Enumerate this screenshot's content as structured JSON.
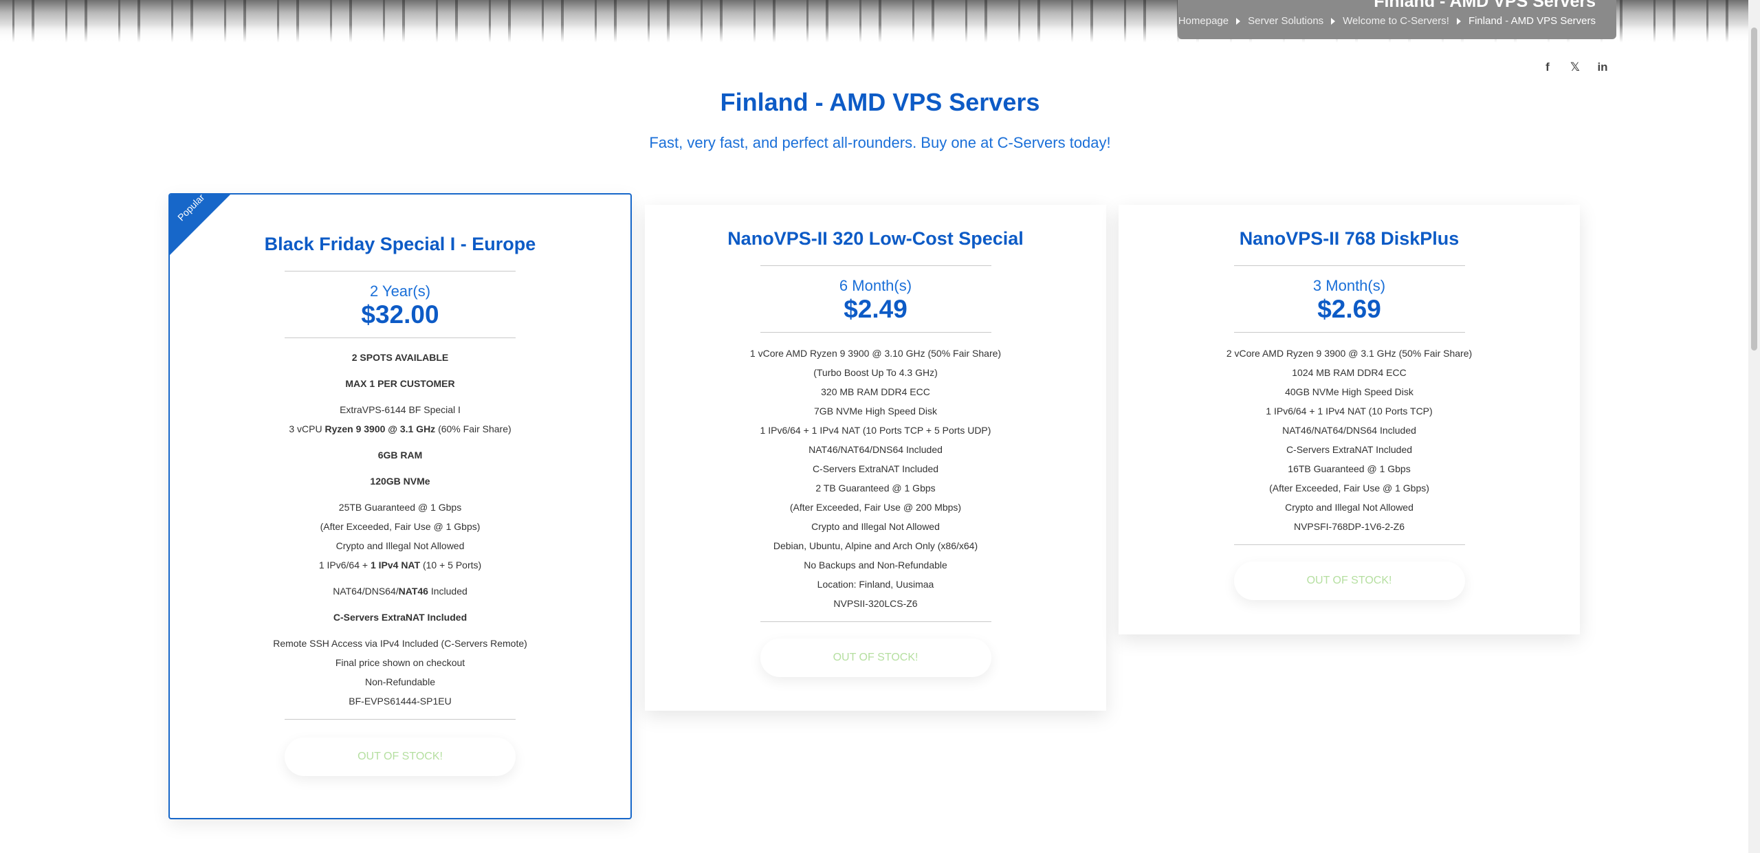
{
  "header": {
    "title": "Finland - AMD VPS Servers",
    "breadcrumb": [
      "Homepage",
      "Server Solutions",
      "Welcome to C-Servers!",
      "Finland - AMD VPS Servers"
    ]
  },
  "social": {
    "facebook": "f",
    "x": "𝕏",
    "linkedin": "in"
  },
  "main": {
    "heading": "Finland - AMD VPS Servers",
    "subheading": "Fast, very fast, and perfect all-rounders. Buy one at C-Servers today!"
  },
  "plans": [
    {
      "ribbon": "Popular",
      "title": "Black Friday Special I - Europe",
      "period": "2 Year(s)",
      "price": "$32.00",
      "features": {
        "spots": "2 SPOTS AVAILABLE",
        "limit": "MAX 1 PER CUSTOMER",
        "name": "ExtraVPS-6144 BF Special I",
        "cpu_pre": "3 vCPU ",
        "cpu_bold": "Ryzen 9 3900 @ 3.1 GHz",
        "cpu_post": " (60% Fair Share)",
        "ram": "6GB RAM",
        "disk": "120GB NVMe",
        "traffic": "25TB Guaranteed @ 1 Gbps",
        "traffic_after": "(After Exceeded, Fair Use @ 1 Gbps)",
        "crypto": "Crypto and Illegal Not Allowed",
        "ip_pre": "1 IPv6/64 + ",
        "ip_bold": "1 IPv4 NAT",
        "ip_post": " (10 + 5 Ports)",
        "nat_pre": "NAT64/DNS64/",
        "nat_bold": "NAT46",
        "nat_post": " Included",
        "extranat": "C-Servers ExtraNAT Included",
        "ssh": "Remote SSH Access via IPv4 Included (C-Servers Remote)",
        "checkout": "Final price shown on checkout",
        "refund": "Non-Refundable",
        "sku": "BF-EVPS61444-SP1EU"
      },
      "button": "OUT OF STOCK!"
    },
    {
      "title": "NanoVPS-II 320 Low-Cost Special",
      "period": "6 Month(s)",
      "price": "$2.49",
      "features": [
        "1 vCore AMD Ryzen 9 3900 @ 3.10 GHz (50% Fair Share)",
        "(Turbo Boost Up To 4.3 GHz)",
        "320 MB RAM DDR4 ECC",
        "7GB NVMe High Speed Disk",
        "1 IPv6/64 + 1 IPv4 NAT (10 Ports TCP + 5 Ports UDP)",
        "NAT46/NAT64/DNS64 Included",
        "C-Servers ExtraNAT Included",
        "2 TB Guaranteed @ 1 Gbps",
        "(After Exceeded, Fair Use @ 200 Mbps)",
        "Crypto and Illegal Not Allowed",
        "Debian, Ubuntu, Alpine and Arch Only (x86/x64)",
        "No Backups and Non-Refundable",
        "Location: Finland, Uusimaa",
        "NVPSII-320LCS-Z6"
      ],
      "button": "OUT OF STOCK!"
    },
    {
      "title": "NanoVPS-II 768 DiskPlus",
      "period": "3 Month(s)",
      "price": "$2.69",
      "features": [
        "2 vCore AMD Ryzen 9 3900 @ 3.1 GHz (50% Fair Share)",
        "1024 MB RAM DDR4 ECC",
        "40GB NVMe High Speed Disk",
        "1 IPv6/64 + 1 IPv4 NAT (10 Ports TCP)",
        "NAT46/NAT64/DNS64 Included",
        "C-Servers ExtraNAT Included",
        "16TB Guaranteed @ 1 Gbps",
        "(After Exceeded, Fair Use @ 1 Gbps)",
        "Crypto and Illegal Not Allowed",
        "NVPSFI-768DP-1V6-2-Z6"
      ],
      "button": "OUT OF STOCK!"
    }
  ]
}
